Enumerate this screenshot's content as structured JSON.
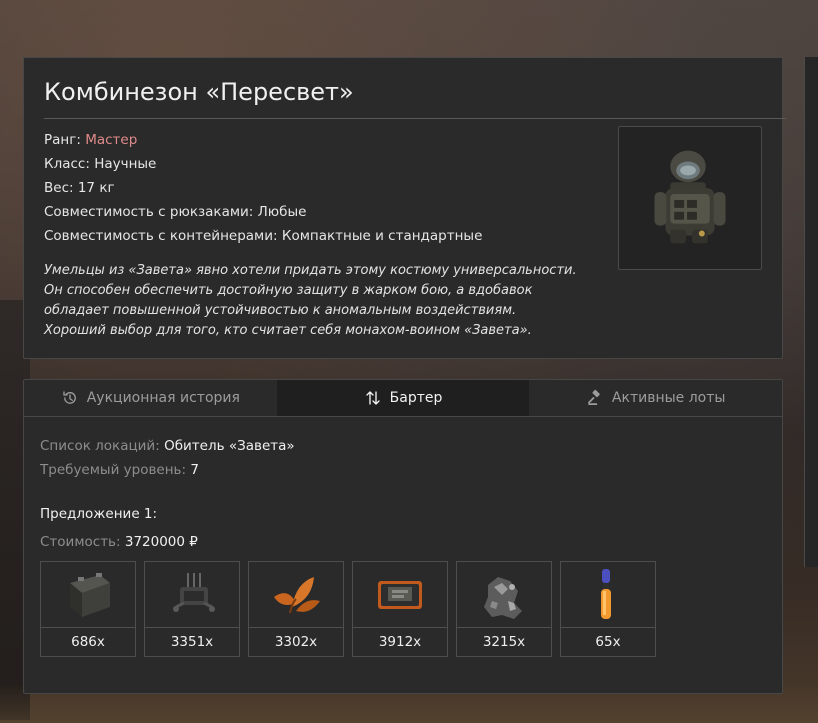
{
  "item": {
    "title": "Комбинезон «Пересвет»",
    "rank_label": "Ранг:",
    "rank_value": "Мастер",
    "rank_color": "#e08a8a",
    "class_label": "Класс:",
    "class_value": "Научные",
    "weight_label": "Вес:",
    "weight_value": "17 кг",
    "backpack_label": "Совместимость с рюкзаками:",
    "backpack_value": "Любые",
    "container_label": "Совместимость с контейнерами:",
    "container_value": "Компактные и стандартные",
    "description_lines": [
      "Умельцы из «Завета» явно хотели придать этому костюму универсальности.",
      "Он способен обеспечить достойную защиту в жарком бою, а вдобавок",
      "обладает повышенной устойчивостью к аномальным воздействиям.",
      "Хороший выбор для того, кто считает себя монахом-воином «Завета»."
    ],
    "image_icon": "armor-suit-icon"
  },
  "tabs": [
    {
      "label": "Аукционная история",
      "icon": "history-icon",
      "active": false
    },
    {
      "label": "Бартер",
      "icon": "swap-arrows-icon",
      "active": true
    },
    {
      "label": "Активные лоты",
      "icon": "gavel-icon",
      "active": false
    }
  ],
  "barter": {
    "locations_label": "Список локаций:",
    "locations_value": "Обитель «Завета»",
    "level_label": "Требуемый уровень:",
    "level_value": "7",
    "offer_title": "Предложение 1:",
    "cost_label": "Стоимость:",
    "cost_value": "3720000 ₽",
    "ingredients": [
      {
        "icon": "battery-icon",
        "count": "686x"
      },
      {
        "icon": "gadget-icon",
        "count": "3351x"
      },
      {
        "icon": "orange-plant-icon",
        "count": "3302x"
      },
      {
        "icon": "pda-device-icon",
        "count": "3912x"
      },
      {
        "icon": "ore-chunk-icon",
        "count": "3215x"
      },
      {
        "icon": "injector-icon",
        "count": "65x"
      }
    ]
  }
}
